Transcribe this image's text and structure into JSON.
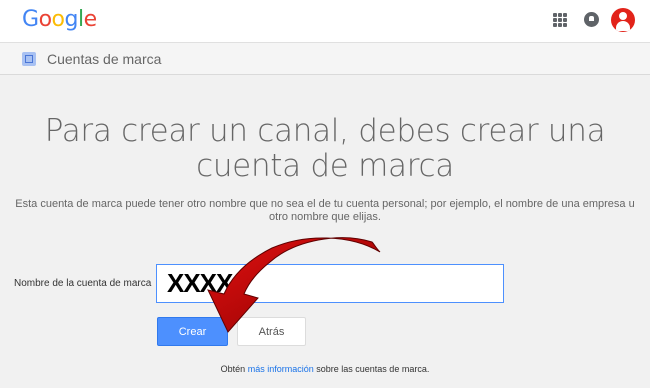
{
  "header": {
    "logo_letters": [
      "G",
      "o",
      "o",
      "g",
      "l",
      "e"
    ],
    "logo_colors": [
      "#4285f4",
      "#ea4335",
      "#fbbc05",
      "#4285f4",
      "#34a853",
      "#ea4335"
    ]
  },
  "subbar": {
    "title": "Cuentas de marca"
  },
  "main": {
    "headline_line1": "Para crear un canal, debes crear una",
    "headline_line2": "cuenta de marca",
    "description": "Esta cuenta de marca puede tener otro nombre que no sea el de tu cuenta personal; por ejemplo, el nombre de una empresa u otro nombre que elijas.",
    "field_label": "Nombre de la cuenta de marca",
    "field_value": "XXXX",
    "create_label": "Crear",
    "back_label": "Atrás",
    "footer_prefix": "Obtén",
    "footer_link": "más información",
    "footer_suffix": "sobre las cuentas de marca."
  },
  "colors": {
    "accent": "#4d90fe",
    "arrow": "#cc0000",
    "avatar": "#e2231a"
  }
}
